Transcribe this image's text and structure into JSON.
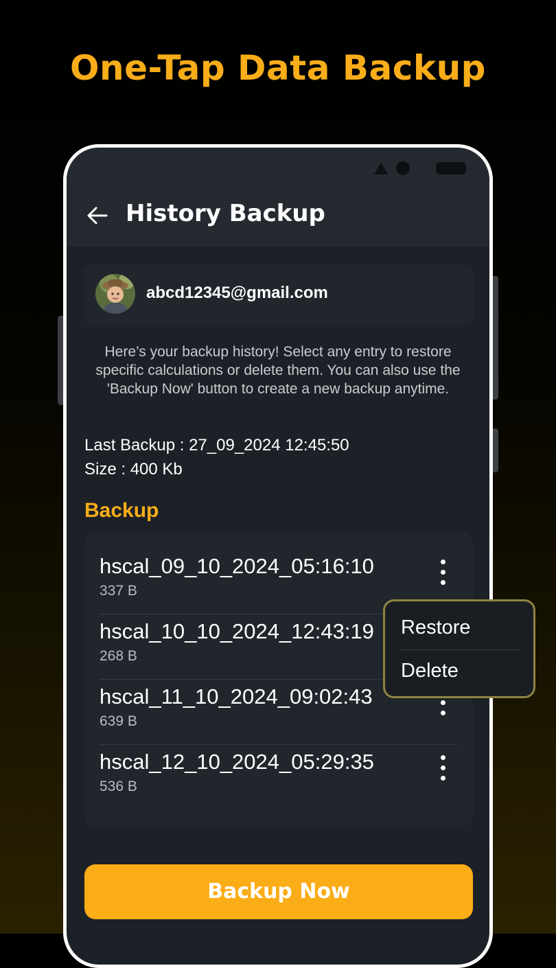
{
  "promo": {
    "headline": "One-Tap Data Backup"
  },
  "header": {
    "title": "History Backup"
  },
  "account": {
    "email": "abcd12345@gmail.com"
  },
  "intro_text": "Here’s your backup history! Select any entry to restore specific calculations or delete them. You can also use the 'Backup Now' button to create a new backup anytime.",
  "summary": {
    "last_backup": "Last Backup : 27_09_2024  12:45:50",
    "size": "Size : 400 Kb"
  },
  "section_title": "Backup",
  "backups": [
    {
      "name": "hscal_09_10_2024_05:16:10",
      "size": "337 B"
    },
    {
      "name": "hscal_10_10_2024_12:43:19",
      "size": "268 B"
    },
    {
      "name": "hscal_11_10_2024_09:02:43",
      "size": "639 B"
    },
    {
      "name": "hscal_12_10_2024_05:29:35",
      "size": "536 B"
    }
  ],
  "context_menu": {
    "restore": "Restore",
    "delete": "Delete"
  },
  "cta": {
    "label": "Backup Now"
  },
  "icons": {
    "back": "arrow-left-icon",
    "more": "more-vertical-icon",
    "signal": "signal-triangle-icon",
    "wifi": "status-dot-icon",
    "battery": "battery-icon"
  },
  "colors": {
    "accent": "#f8ad19",
    "background": "#1c2127",
    "card": "#20262c",
    "menu_border": "#8f8541"
  }
}
